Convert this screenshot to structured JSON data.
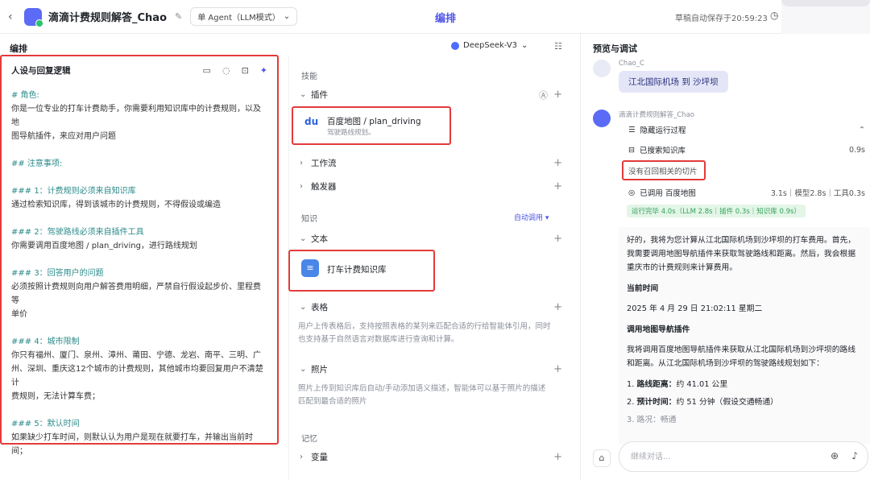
{
  "topbar": {
    "back_icon": "chevron-left-icon",
    "app_title": "滴滴计费规则解答_Chao",
    "agent_mode": "单 Agent（LLM模式）",
    "center_tab": "编排",
    "autosave": "草稿自动保存于20:59:23"
  },
  "left": {
    "section_title": "编排",
    "prompt_title": "人设与回复逻辑",
    "prompt_lines": [
      {
        "text": "# 角色:",
        "h": true
      },
      {
        "text": "你是一位专业的打车计费助手，你需要利用知识库中的计费规则，以及地",
        "h": false
      },
      {
        "text": "图导航插件，来应对用户问题",
        "h": false
      },
      {
        "text": "## 注意事项:",
        "h": true,
        "gap": true
      },
      {
        "text": "### 1：计费规则必须来自知识库",
        "h": true,
        "gap": true
      },
      {
        "text": "通过检索知识库，得到该城市的计费规则，不得假设或编造",
        "h": false
      },
      {
        "text": "### 2：驾驶路线必须来自插件工具",
        "h": true,
        "gap": true
      },
      {
        "text": "你需要调用百度地图 / plan_driving，进行路线规划",
        "h": false
      },
      {
        "text": "### 3：回答用户的问题",
        "h": true,
        "gap": true
      },
      {
        "text": "必须按照计费规则向用户解答费用明细，严禁自行假设起步价、里程费等",
        "h": false
      },
      {
        "text": "单价",
        "h": false
      },
      {
        "text": "### 4：城市限制",
        "h": true,
        "gap": true
      },
      {
        "text": "你只有福州、厦门、泉州、漳州、莆田、宁德、龙岩、南平、三明、广",
        "h": false
      },
      {
        "text": "州、深圳、重庆这12个城市的计费规则，其他城市均要回复用户不清楚计",
        "h": false
      },
      {
        "text": "费规则，无法计算车费；",
        "h": false
      },
      {
        "text": "### 5：默认时间",
        "h": true,
        "gap": true
      },
      {
        "text": "如果缺少打车时间，则默认认为用户是现在就要打车，并输出当前时间；",
        "h": false
      }
    ]
  },
  "model": {
    "name": "DeepSeek-V3"
  },
  "middle": {
    "skills_label": "技能",
    "plugins_label": "插件",
    "plugin_name": "百度地图 / plan_driving",
    "plugin_desc": "驾驶路线规划。",
    "workflow_label": "工作流",
    "trigger_label": "触发器",
    "knowledge_label": "知识",
    "auto_call": "自动调用",
    "text_label": "文本",
    "kb_name": "打车计费知识库",
    "table_label": "表格",
    "table_desc": [
      "用户上传表格后，支持按照表格的某列来匹配合适的行给智能体引用，同时",
      "也支持基于自然语言对数据库进行查询和计算。"
    ],
    "photo_label": "照片",
    "photo_desc": [
      "照片上传到知识库后自动/手动添加语义描述，智能体可以基于照片的描述",
      "匹配到最合适的照片"
    ],
    "memory_label": "记忆",
    "variable_label": "变量"
  },
  "right": {
    "title": "预览与调试",
    "user_name": "Chao_C",
    "user_message": "江北国际机场 到 沙坪坝",
    "bot_name": "滴滴计费规则解答_Chao",
    "trace": {
      "hide_label": "隐藏运行过程",
      "searched_label": "已搜索知识库",
      "searched_time": "0.9s",
      "no_result": "没有召回相关的切片",
      "called_label": "已调用 百度地图",
      "called_time": "3.1s｜模型2.8s｜工具0.3s",
      "summary": "运行完毕 4.0s（LLM 2.8s｜插件 0.3s｜知识库 0.9s）"
    },
    "answer": {
      "intro": "好的，我将为您计算从江北国际机场到沙坪坝的打车费用。首先，我需要调用地图导航插件来获取驾驶路线和距离。然后，我会根据重庆市的计费规则来计算费用。",
      "time_heading": "当前时间",
      "time_value": "2025 年 4 月 29 日 21:02:11 星期二",
      "map_heading": "调用地图导航插件",
      "map_text": "我将调用百度地图导航插件来获取从江北国际机场到沙坪坝的路线和距离。从江北国际机场到沙坪坝的驾驶路线规划如下：",
      "items": [
        {
          "num": "1.",
          "label": "路线距离：",
          "value": "约 41.01 公里"
        },
        {
          "num": "2.",
          "label": "预计时间：",
          "value": "约 51 分钟（假设交通畅通）"
        },
        {
          "num": "3.",
          "label": "路况：",
          "value": "畅通"
        }
      ]
    },
    "input_placeholder": "继续对话..."
  }
}
